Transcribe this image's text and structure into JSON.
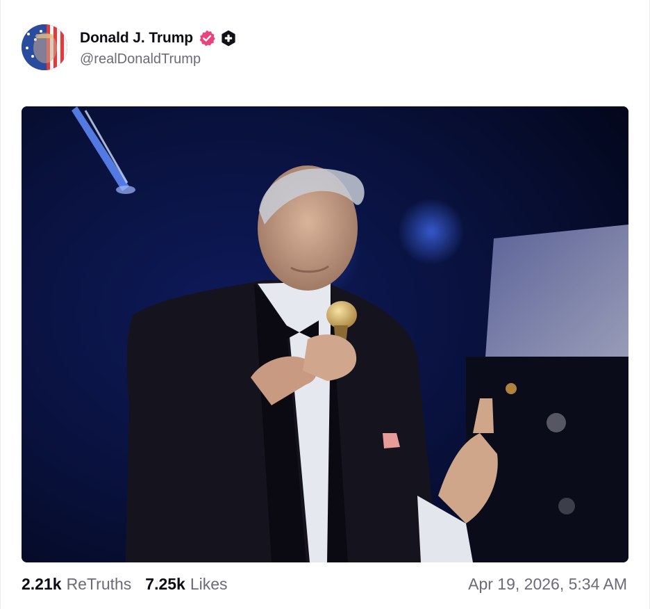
{
  "post": {
    "author": {
      "display_name": "Donald J. Trump",
      "handle": "@realDonaldTrump",
      "verified_icon": "verified-badge-icon",
      "plus_icon": "plus-badge-icon",
      "verified_color": "#e8437a"
    },
    "media": {
      "type": "video-still"
    },
    "stats": {
      "retruths_count": "2.21k",
      "retruths_label": "ReTruths",
      "likes_count": "7.25k",
      "likes_label": "Likes"
    },
    "timestamp": "Apr 19, 2026, 5:34 AM"
  }
}
